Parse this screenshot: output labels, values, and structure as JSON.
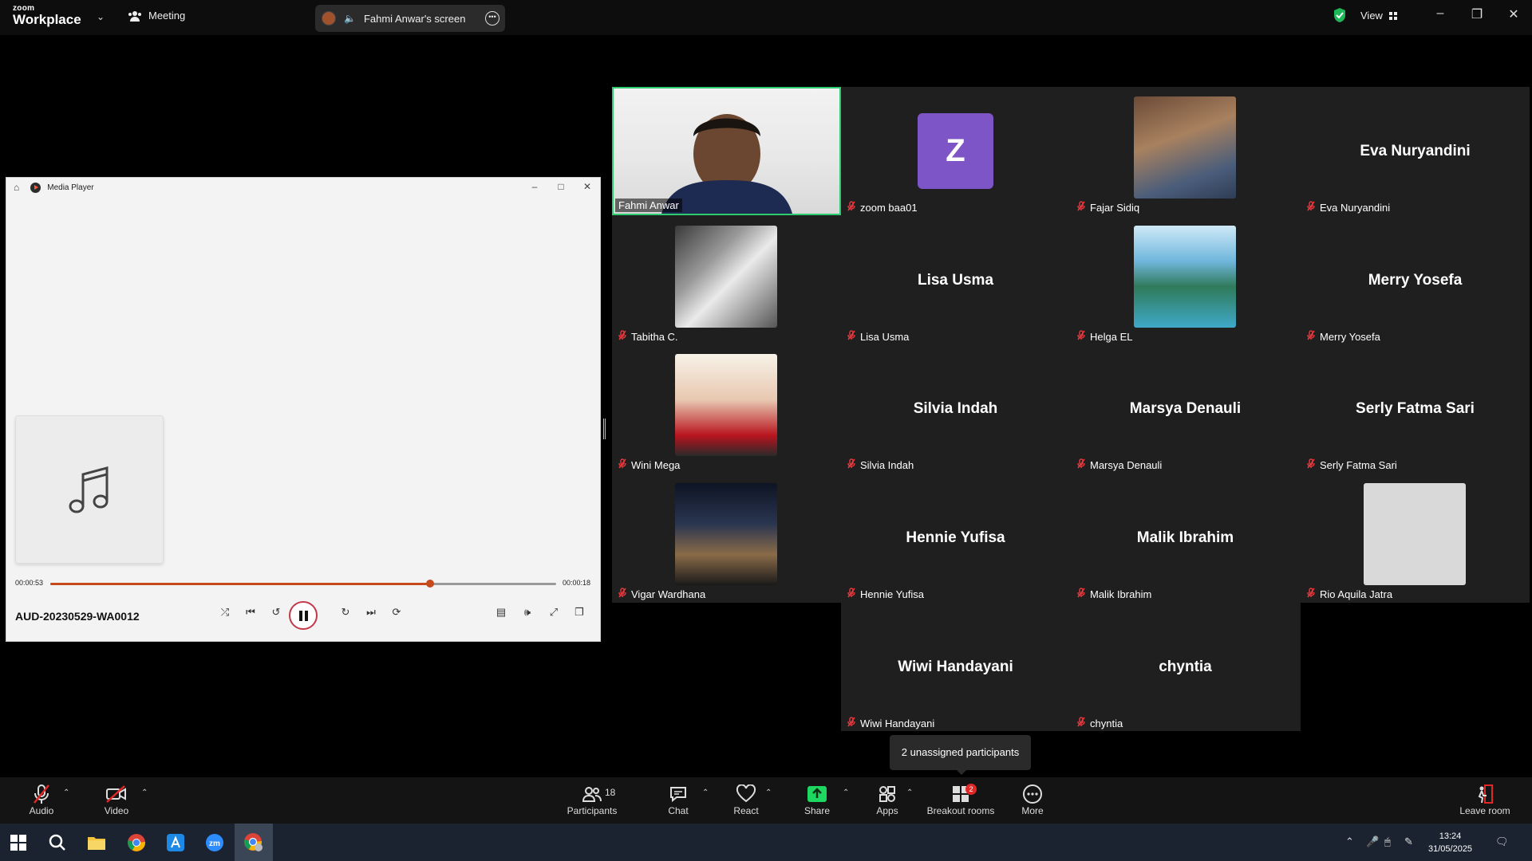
{
  "app": {
    "brand_top": "zoom",
    "brand_bottom": "Workplace",
    "meeting_label": "Meeting",
    "screen_share_label": "Fahmi Anwar's screen",
    "view_label": "View"
  },
  "media_player": {
    "title": "Media Player",
    "file_name": "AUD-20230529-WA0012",
    "elapsed": "00:00:53",
    "remaining": "00:00:18",
    "progress_fraction": 0.75,
    "accent_color": "#c74a1b"
  },
  "participants": [
    {
      "name": "Fahmi Anwar",
      "display": "video",
      "big_name": ""
    },
    {
      "name": "zoom baa01",
      "display": "initial",
      "big_name": "Z"
    },
    {
      "name": "Fajar Sidiq",
      "display": "photo",
      "big_name": ""
    },
    {
      "name": "Eva Nuryandini",
      "display": "name",
      "big_name": "Eva Nuryandini"
    },
    {
      "name": "Tabitha C.",
      "display": "photo",
      "big_name": ""
    },
    {
      "name": "Lisa Usma",
      "display": "name",
      "big_name": "Lisa Usma"
    },
    {
      "name": "Helga EL",
      "display": "photo",
      "big_name": ""
    },
    {
      "name": "Merry Yosefa",
      "display": "name",
      "big_name": "Merry Yosefa"
    },
    {
      "name": "Wini Mega",
      "display": "photo",
      "big_name": ""
    },
    {
      "name": "Silvia Indah",
      "display": "name",
      "big_name": "Silvia Indah"
    },
    {
      "name": "Marsya Denauli",
      "display": "name",
      "big_name": "Marsya Denauli"
    },
    {
      "name": "Serly Fatma Sari",
      "display": "name",
      "big_name": "Serly Fatma Sari"
    },
    {
      "name": "Vigar Wardhana",
      "display": "photo",
      "big_name": ""
    },
    {
      "name": "Hennie Yufisa",
      "display": "name",
      "big_name": "Hennie Yufisa"
    },
    {
      "name": "Malik Ibrahim",
      "display": "name",
      "big_name": "Malik Ibrahim"
    },
    {
      "name": "Rio Aquila Jatra",
      "display": "blank",
      "big_name": ""
    },
    {
      "name": "Wiwi Handayani",
      "display": "name",
      "big_name": "Wiwi Handayani"
    },
    {
      "name": "chyntia",
      "display": "name",
      "big_name": "chyntia"
    }
  ],
  "tooltip": "2 unassigned participants",
  "toolbar": {
    "audio": "Audio",
    "video": "Video",
    "participants": "Participants",
    "participants_count": "18",
    "chat": "Chat",
    "react": "React",
    "share": "Share",
    "apps": "Apps",
    "breakout": "Breakout rooms",
    "breakout_badge": "2",
    "more": "More",
    "leave": "Leave room",
    "share_color": "#1ed760",
    "leave_color": "#e02828"
  },
  "taskbar": {
    "time": "13:24",
    "date": "31/05/2025"
  }
}
